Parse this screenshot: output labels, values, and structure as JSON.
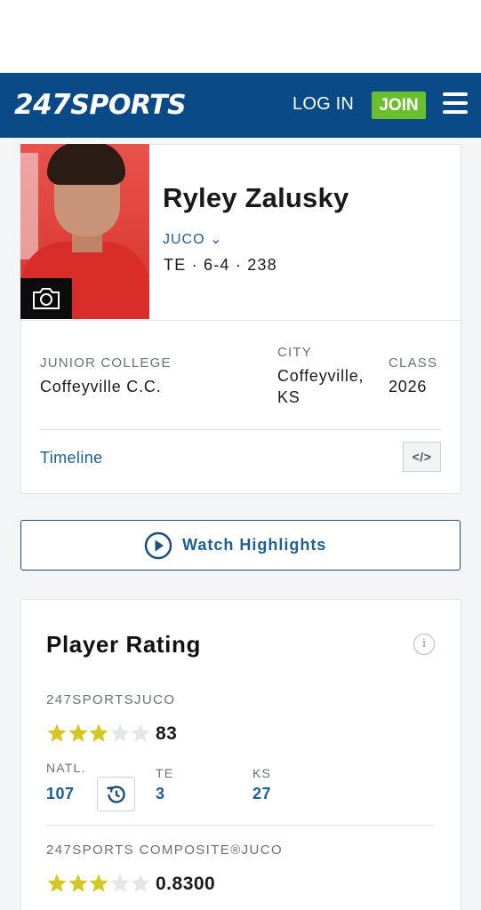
{
  "header": {
    "logo_number": "247",
    "logo_text": "SPORTS",
    "login_label": "LOG IN",
    "join_label": "JOIN",
    "menu_icon": "hamburger-menu-icon"
  },
  "player": {
    "name": "Ryley Zalusky",
    "level": "JUCO",
    "measurements": "TE · 6-4 · 238",
    "camera_icon": "camera-icon"
  },
  "details": {
    "school_label": "JUNIOR COLLEGE",
    "school_value": "Coffeyville C.C.",
    "city_label": "CITY",
    "city_line1": "Coffeyville,",
    "city_line2": "KS",
    "class_label": "CLASS",
    "class_value": "2026",
    "timeline_label": "Timeline",
    "embed_label": "</>"
  },
  "highlights": {
    "label": "Watch Highlights",
    "icon": "play-circle-icon"
  },
  "rating": {
    "title": "Player Rating",
    "info_icon": "info-icon",
    "info_glyph": "i",
    "sports_section": "247SPORTSJUCO",
    "sports_stars": 3,
    "sports_score": "83",
    "natl_label": "NATL.",
    "natl_value": "107",
    "pos_label": "TE",
    "pos_value": "3",
    "state_label": "KS",
    "state_value": "27",
    "history_icon": "history-icon",
    "composite_section": "247SPORTS COMPOSITE®JUCO",
    "composite_stars": 3,
    "composite_score": "0.8300",
    "max_stars": 5,
    "star_filled_color": "#d4c623",
    "star_empty_color": "#e4e5e7"
  },
  "colors": {
    "brand_blue": "#0a4a86",
    "join_green": "#6cbf2c",
    "link_blue": "#1a5f99"
  }
}
